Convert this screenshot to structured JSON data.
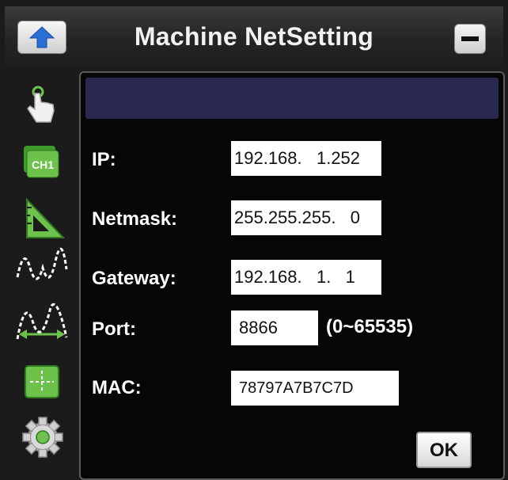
{
  "window": {
    "title": "Machine NetSetting"
  },
  "toolbar": {
    "icons": [
      "touch-hand-icon",
      "channel-ch1-icon",
      "ruler-triangle-icon",
      "waveform-icon",
      "waveform-measure-icon",
      "cursor-crosshair-icon",
      "gear-icon"
    ],
    "ch1_text": "CH1"
  },
  "form": {
    "ip": {
      "label": "IP:",
      "value": "192.168.   1.252"
    },
    "netmask": {
      "label": "Netmask:",
      "value": "255.255.255.   0"
    },
    "gateway": {
      "label": "Gateway:",
      "value": "192.168.   1.   1"
    },
    "port": {
      "label": "Port:",
      "value": "8866",
      "range": "(0~65535)"
    },
    "mac": {
      "label": "MAC:",
      "value": "78797A7B7C7D"
    }
  },
  "ok_label": "OK",
  "colors": {
    "panel_header": "#29294f",
    "accent_green": "#6dc24b",
    "arrow_blue": "#2a6fd6"
  }
}
